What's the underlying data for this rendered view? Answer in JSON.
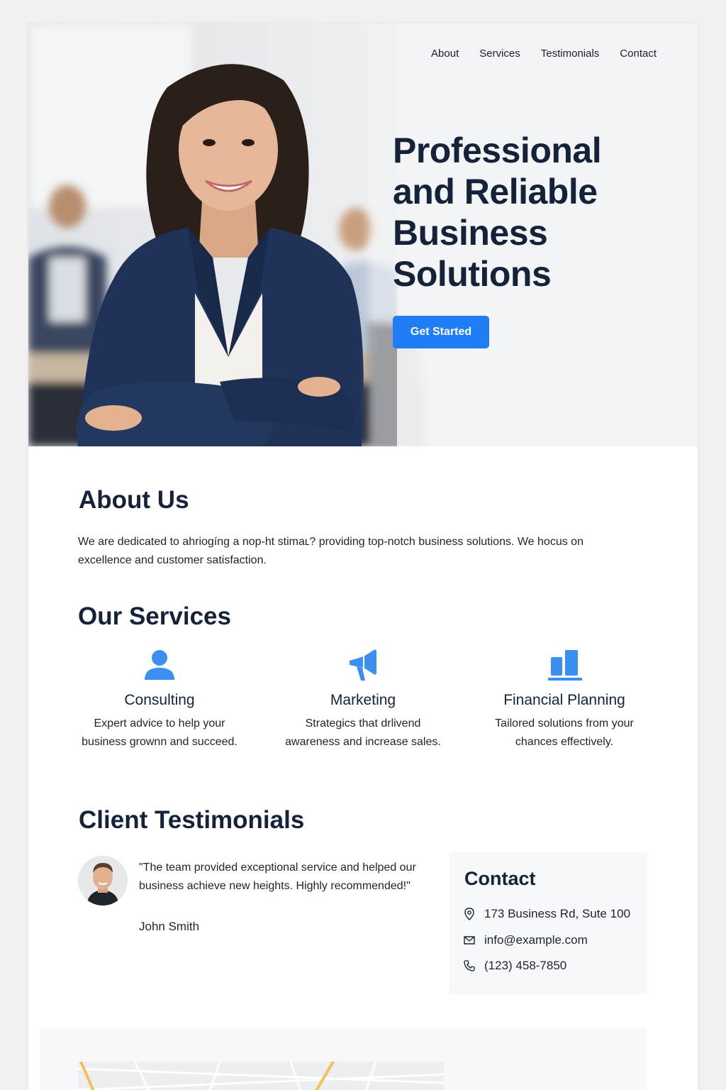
{
  "nav": {
    "items": [
      "About",
      "Services",
      "Testimonials",
      "Contact"
    ]
  },
  "hero": {
    "title": "Professional and Reliable Business Solutions",
    "cta_label": "Get Started"
  },
  "about": {
    "title": "About Us",
    "text": "We are dedicated to ahriogíng a nop-ht stimaʟ? providing top-notch business solutions. We hocus on excellence and customer satisfaction."
  },
  "services": {
    "title": "Our Services",
    "items": [
      {
        "icon": "person-icon",
        "name": "Consulting",
        "desc": "Expert advice to help your business grownn and succeed."
      },
      {
        "icon": "megaphone-icon",
        "name": "Marketing",
        "desc": "Strategics that drlivend awareness and increase sales."
      },
      {
        "icon": "bar-chart-icon",
        "name": "Financial Planning",
        "desc": "Tailored solutions from your chances effectively."
      }
    ]
  },
  "testimonials": {
    "title": "Client Testimonials",
    "quote": "\"The team provided exceptional service and helped our business achieve new heights. Highly recommended!\"",
    "author": "John Smith"
  },
  "contact": {
    "title": "Contact",
    "address": "173 Business Rd, Sute 100",
    "email": "info@example.com",
    "phone": "(123) 458-7850"
  },
  "colors": {
    "accent": "#1f7ef5",
    "heading": "#15233a",
    "icon": "#3b8ff0"
  }
}
